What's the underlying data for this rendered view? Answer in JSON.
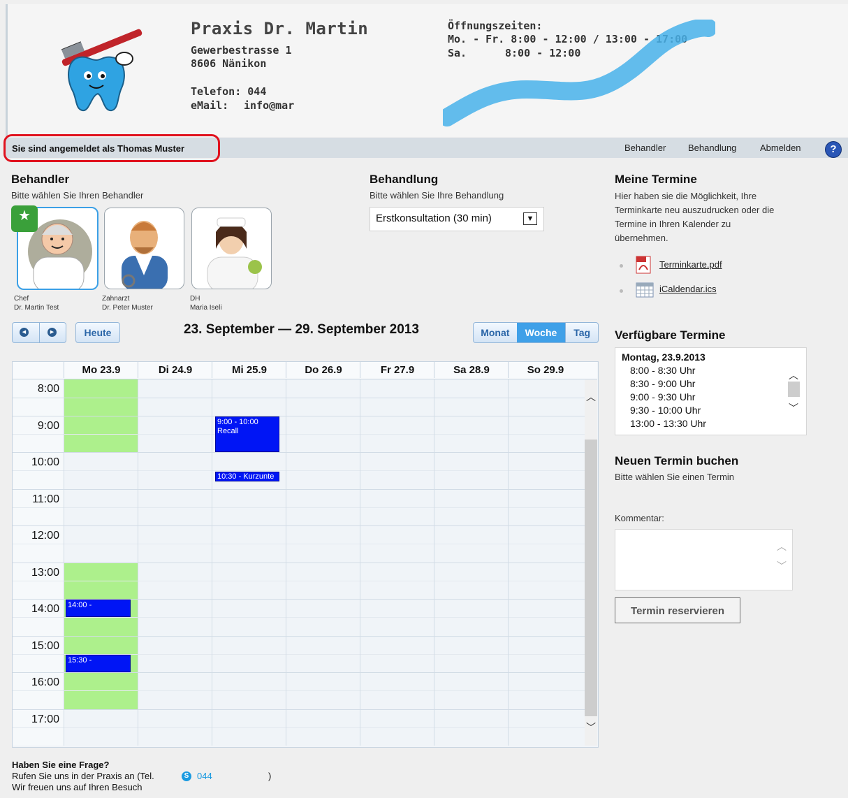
{
  "header": {
    "practice_name": "Praxis Dr. Martin",
    "street": "Gewerbestrasse 1",
    "city": "8606 Nänikon",
    "phone": "Telefon: 044",
    "email_label": "eMail:",
    "email_value": "info@mar",
    "hours_title": "Öffnungszeiten:",
    "hours_weekdays": "Mo. - Fr. 8:00 - 12:00 / 13:00 - 17:00",
    "hours_sat_label": "Sa.",
    "hours_sat": "8:00 - 12:00"
  },
  "topbar": {
    "login_text": "Sie sind angemeldet als Thomas Muster",
    "nav": [
      "Behandler",
      "Behandlung",
      "Abmelden"
    ],
    "help_label": "?"
  },
  "behandler": {
    "title": "Behandler",
    "subtitle": "Bitte wählen Sie Ihren Behandler",
    "doctors": [
      {
        "role": "Chef",
        "name": "Dr. Martin Test",
        "selected": true
      },
      {
        "role": "Zahnarzt",
        "name": "Dr. Peter Muster",
        "selected": false
      },
      {
        "role": "DH",
        "name": "Maria Iseli",
        "selected": false
      }
    ]
  },
  "behandlung": {
    "title": "Behandlung",
    "subtitle": "Bitte wählen Sie Ihre Behandlung",
    "selected": "Erstkonsultation (30 min)"
  },
  "calendar": {
    "today_label": "Heute",
    "date_range": "23. September — 29. September 2013",
    "views": [
      "Monat",
      "Woche",
      "Tag"
    ],
    "active_view": "Woche",
    "days": [
      "Mo 23.9",
      "Di 24.9",
      "Mi 25.9",
      "Do 26.9",
      "Fr 27.9",
      "Sa 28.9",
      "So 29.9"
    ],
    "times": [
      "8:00",
      "9:00",
      "10:00",
      "11:00",
      "12:00",
      "13:00",
      "14:00",
      "15:00",
      "16:00",
      "17:00"
    ],
    "events": [
      {
        "day": "Mi 25.9",
        "time": "9:00 - 10:00",
        "title": "Recall"
      },
      {
        "day": "Mi 25.9",
        "time": "10:30 - Kurzunte",
        "title": ""
      },
      {
        "day": "Mo 23.9",
        "time": "14:00 -",
        "title": ""
      },
      {
        "day": "Mo 23.9",
        "time": "15:30 -",
        "title": ""
      }
    ],
    "availability_color": "#adf08c",
    "event_color": "#0015f5"
  },
  "footer": {
    "question": "Haben Sie eine Frage?",
    "call_prefix": "Rufen Sie uns in der Praxis an (Tel.",
    "call_number": "044",
    "call_suffix": ")",
    "thanks": "Wir freuen uns auf Ihren Besuch"
  },
  "meine_termine": {
    "title": "Meine Termine",
    "text_lines": [
      "Hier haben sie die Möglichkeit, Ihre",
      "Terminkarte neu auszudrucken oder die",
      "Termine in Ihren Kalender zu",
      "übernehmen."
    ],
    "files": [
      "Terminkarte.pdf",
      "iCaldendar.ics"
    ]
  },
  "verfuegbare": {
    "title": "Verfügbare Termine",
    "date": "Montag, 23.9.2013",
    "slots": [
      "8:00 - 8:30 Uhr",
      "8:30 - 9:00 Uhr",
      "9:00 - 9:30 Uhr",
      "9:30 - 10:00 Uhr",
      "13:00 - 13:30 Uhr"
    ]
  },
  "neuer_termin": {
    "title": "Neuen Termin buchen",
    "subtitle": "Bitte wählen Sie einen Termin",
    "comment_label": "Kommentar:",
    "button": "Termin reservieren"
  }
}
